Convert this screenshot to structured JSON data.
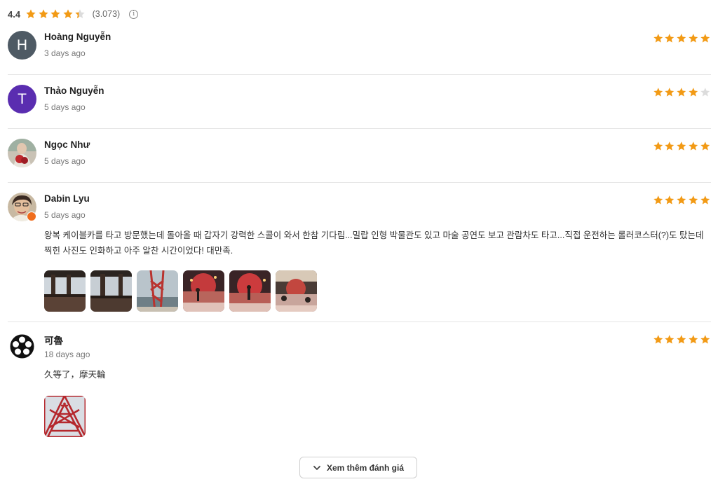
{
  "summary": {
    "score": "4.4",
    "rating": 4.4,
    "count": "(3.073)",
    "info_icon": "info-icon"
  },
  "colors": {
    "star_filled": "#f29a15",
    "star_empty": "#dcdcdc",
    "divider": "#e6e6e6"
  },
  "reviews": [
    {
      "name": "Hoàng Nguyễn",
      "date": "3 days ago",
      "rating": 5,
      "avatar_letter": "H",
      "avatar_color": "#4e5a64"
    },
    {
      "name": "Thảo Nguyễn",
      "date": "5 days ago",
      "rating": 4,
      "avatar_letter": "T",
      "avatar_color": "#5a2db0"
    },
    {
      "name": "Ngọc Như",
      "date": "5 days ago",
      "rating": 5
    },
    {
      "name": "Dabin Lyu",
      "date": "5 days ago",
      "rating": 5,
      "text": "왕복 케이블카를 타고 방문했는데 돌아올 때 갑자기 강력한 스콜이 와서 한참 기다림...밀랍 인형 박물관도 있고 마술 공연도 보고 관람차도 타고...직접 운전하는 롤러코스터(?)도 탔는데 찍힌 사진도 인화하고 아주 알찬 시간이었다! 대만족."
    },
    {
      "name": "可魯",
      "date": "18 days ago",
      "rating": 5,
      "text": "久等了，摩天輪"
    }
  ],
  "more_button": {
    "label": "Xem thêm đánh giá",
    "icon": "chevron-down-icon"
  }
}
